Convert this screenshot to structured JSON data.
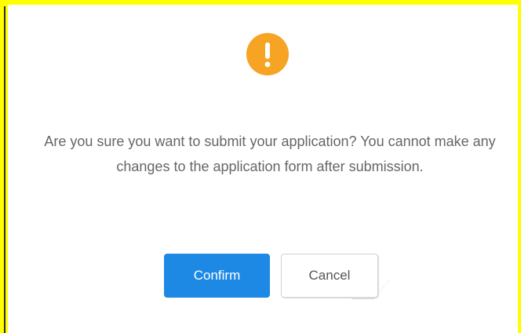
{
  "dialog": {
    "icon": "exclamation-icon",
    "message": "Are you sure you want to submit your application? You cannot make any changes to the application form after submission.",
    "confirm_label": "Confirm",
    "cancel_label": "Cancel"
  },
  "colors": {
    "background_frame": "#ffff00",
    "warning_icon": "#f7a324",
    "confirm_button": "#1e88e5",
    "text": "#666666",
    "cancel_border": "#d2d2d2"
  }
}
